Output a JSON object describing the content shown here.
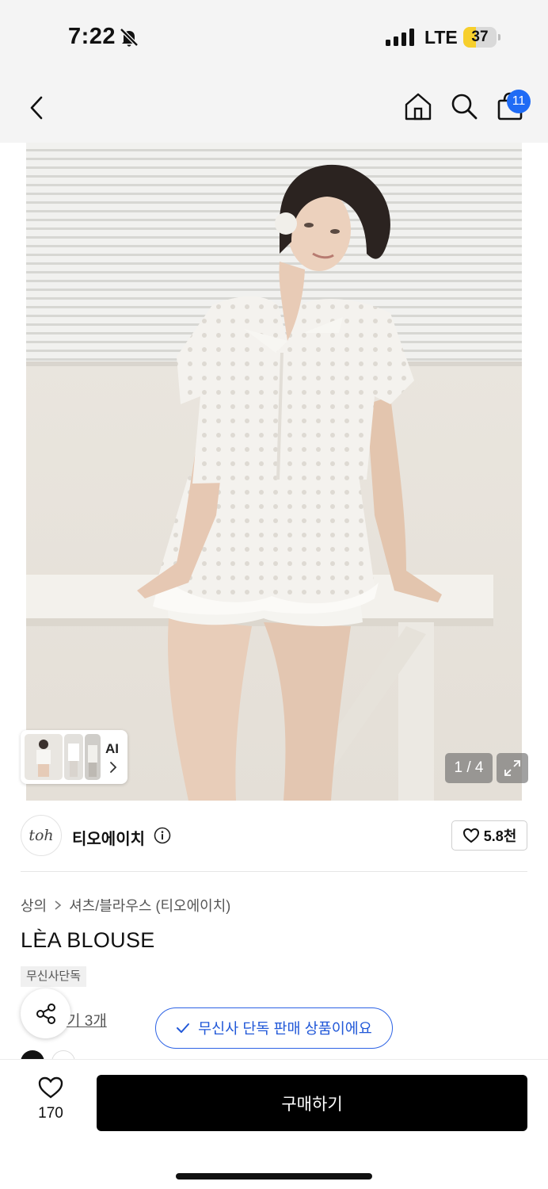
{
  "status_bar": {
    "time": "7:22",
    "network": "LTE",
    "battery_level": "37",
    "battery_fraction": 0.37,
    "icons": [
      "bell-slash-icon",
      "signal-bars-icon",
      "battery-icon"
    ]
  },
  "nav": {
    "icons": [
      "chevron-left-icon",
      "home-icon",
      "search-icon",
      "shopping-bag-icon"
    ],
    "cart_count": "11"
  },
  "gallery": {
    "ai_label": "AI",
    "page_indicator": "1 / 4",
    "icons": [
      "expand-icon",
      "chevron-right-icon"
    ]
  },
  "brand": {
    "logo_text": "toh",
    "name": "티오에이치",
    "like_count": "5.8천",
    "icons": [
      "info-circle-icon",
      "heart-outline-icon"
    ]
  },
  "product": {
    "breadcrumb": [
      "상의",
      "셔츠/블라우스 (티오에이치)"
    ],
    "title": "LÈA BLOUSE",
    "exclusive_tag": "무신사단독",
    "review_text": "기 3개",
    "color_swatches": [
      "#111111",
      "#ffffff"
    ]
  },
  "toast": {
    "text": "무신사 단독 판매 상품이에요",
    "icon": "check-icon",
    "accent": "#2158d8"
  },
  "bottom_bar": {
    "like_count": "170",
    "buy_label": "구매하기",
    "icons": [
      "heart-outline-icon",
      "share-icon"
    ]
  }
}
